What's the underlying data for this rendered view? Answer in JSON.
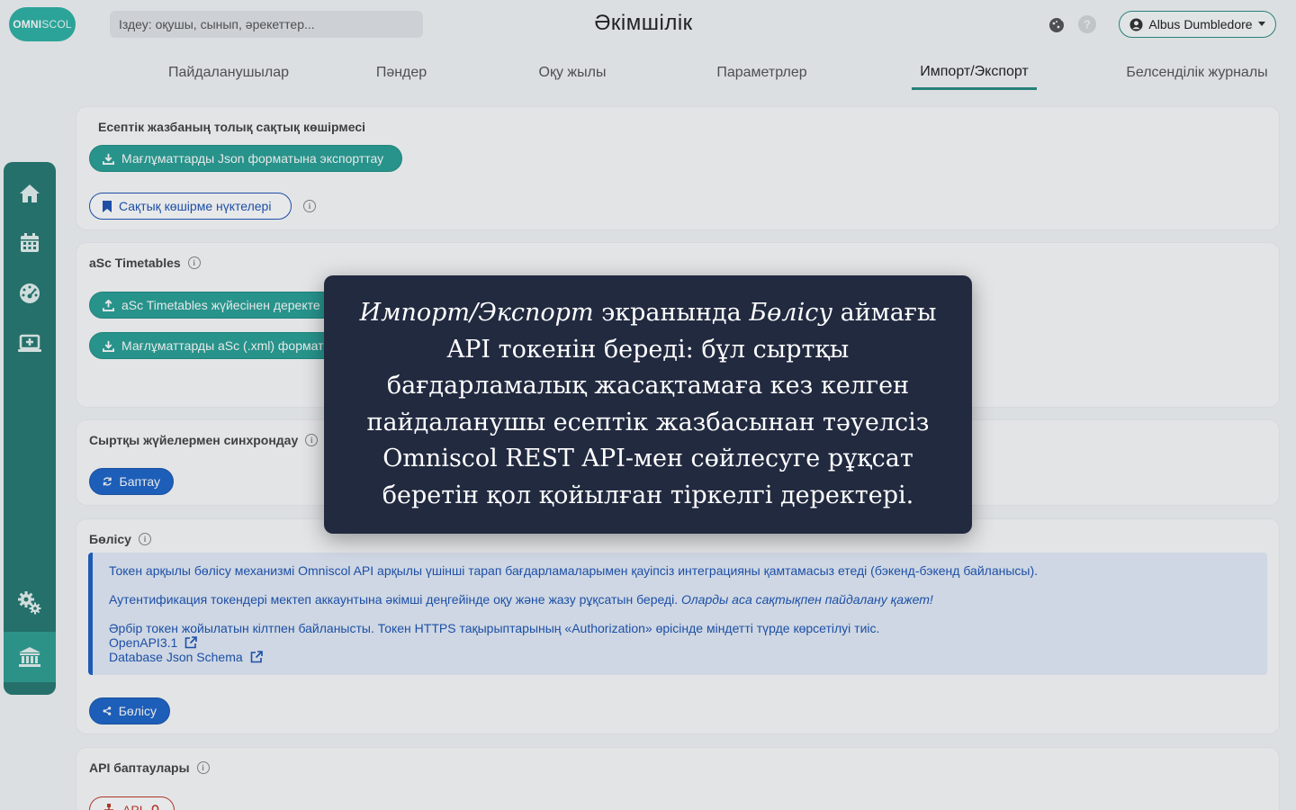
{
  "header": {
    "logo_left": "OMNI",
    "logo_right": "SCOL",
    "search_placeholder": "Іздеу: оқушы, сынып, әрекеттер...",
    "title": "Әкімшілік",
    "user_name": "Albus Dumbledore"
  },
  "tabs": [
    {
      "label": "Пайдаланушылар"
    },
    {
      "label": "Пәндер"
    },
    {
      "label": "Оқу жылы"
    },
    {
      "label": "Параметрлер"
    },
    {
      "label": "Импорт/Экспорт",
      "active": true
    },
    {
      "label": "Белсенділік журналы"
    }
  ],
  "backup": {
    "title": "Есептік жазбаның толық сақтық көшірмесі",
    "export_json_btn": "Мағлұматтарды Json форматына экспорттау",
    "backup_points_btn": "Сақтық көшірме нүктелері"
  },
  "asc": {
    "title": "aSc Timetables",
    "import_btn": "aSc Timetables жүйесінен деректе",
    "export_btn": "Мағлұматтарды aSc (.xml) формат"
  },
  "sync": {
    "title": "Сыртқы жүйелермен синхрондау",
    "settings_btn": "Баптау"
  },
  "share": {
    "title": "Бөлісу",
    "p1": "Токен арқылы бөлісу механизмі Omniscol API арқылы үшінші тарап бағдарламаларымен қауіпсіз интеграцияны қамтамасыз етеді (бэкенд-бэкенд байланысы).",
    "p2_normal": "Аутентификация токендері мектеп аккаунтына әкімші деңгейінде оқу және жазу рұқсатын береді. ",
    "p2_italic": "Оларды аса сақтықпен пайдалану қажет!",
    "p3": "Әрбір токен жойылатын кілтпен байланысты. Токен HTTPS тақырыптарының «Authorization» өрісінде міндетті түрде көрсетілуі тиіс.",
    "link1": "OpenAPI3.1",
    "link2": "Database Json Schema",
    "share_btn": "Бөлісу"
  },
  "api": {
    "title": "API баптаулары",
    "api_btn": "API"
  },
  "tooltip": {
    "part1": "Импорт/Экспорт",
    "part2": " экранында ",
    "part3": "Бөлісу",
    "part4": " аймағы API токенін береді: бұл сыртқы бағдарламалық жасақтамаға кез келген пайдаланушы есептік жазбасынан тәуелсіз Omniscol REST API-мен сөйлесуге рұқсат беретін қол қойылған тіркелгі деректері."
  },
  "colors": {
    "primary_teal": "#2aa197",
    "sidebar": "#287a73",
    "blue": "#1f66c9",
    "tooltip_bg": "#222a40"
  }
}
